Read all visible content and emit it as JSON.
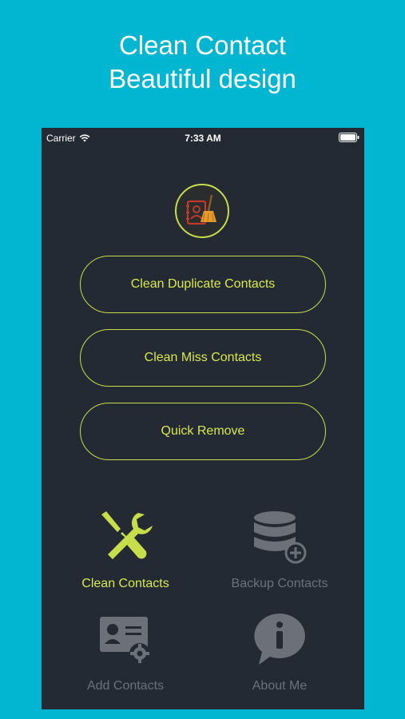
{
  "promo": {
    "line1": "Clean Contact",
    "line2": "Beautiful design"
  },
  "status_bar": {
    "carrier": "Carrier",
    "time": "7:33 AM"
  },
  "logo": {
    "icon": "contacts-broom-icon"
  },
  "buttons": [
    {
      "label": "Clean Duplicate Contacts"
    },
    {
      "label": "Clean Miss Contacts"
    },
    {
      "label": "Quick Remove"
    }
  ],
  "tabs": [
    {
      "label": "Clean Contacts",
      "icon": "tools-icon",
      "active": true
    },
    {
      "label": "Backup Contacts",
      "icon": "database-add-icon",
      "active": false
    },
    {
      "label": "Add Contacts",
      "icon": "contact-card-settings-icon",
      "active": false
    },
    {
      "label": "About Me",
      "icon": "info-bubble-icon",
      "active": false
    }
  ],
  "colors": {
    "background": "#02b5d0",
    "panel": "#242a33",
    "accent": "#c7dd4a",
    "inactive": "#6b7079"
  }
}
